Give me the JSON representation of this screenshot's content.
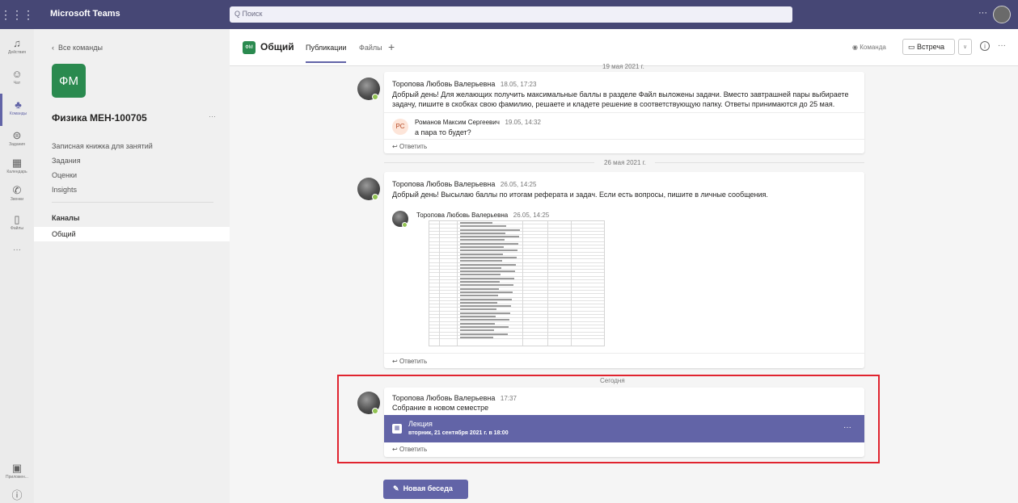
{
  "app": {
    "title": "Microsoft Teams",
    "apps_icon": "grid-icon"
  },
  "search": {
    "placeholder": "Q Поиск"
  },
  "rail": [
    {
      "label": "Действия",
      "icon": "bell-icon"
    },
    {
      "label": "Чат",
      "icon": "chat-icon"
    },
    {
      "label": "Команды",
      "icon": "teams-icon"
    },
    {
      "label": "Задания",
      "icon": "assignments-icon"
    },
    {
      "label": "Календарь",
      "icon": "calendar-icon"
    },
    {
      "label": "Звонки",
      "icon": "phone-icon"
    },
    {
      "label": "Файлы",
      "icon": "file-icon"
    }
  ],
  "rail_bottom": {
    "apps_label": "Приложен...",
    "help_icon": "help-icon"
  },
  "team_panel": {
    "back_label": "Все команды",
    "team_initials": "ФМ",
    "team_name": "Физика МЕН-100705",
    "nav": [
      "Записная книжка для занятий",
      "Задания",
      "Оценки",
      "Insights"
    ],
    "channels_title": "Каналы",
    "channels": [
      "Общий"
    ]
  },
  "header": {
    "channel_initials": "ФМ",
    "channel_name": "Общий",
    "tabs": [
      "Публикации",
      "Файлы"
    ],
    "team_button": "Команда",
    "meet_button": "Встреча"
  },
  "feed": {
    "date_top": "19 мая 2021 г.",
    "post1": {
      "author": "Торопова Любовь Валерьевна",
      "time": "18.05, 17:23",
      "text": "Добрый день! Для желающих получить максимальные баллы в разделе Файл выложены задачи. Вместо завтрашней пары выбираете задачу, пишите в скобках свою фамилию, решаете и кладете решение в соответствующую папку. Ответы принимаются до 25 мая.",
      "reply": {
        "initials": "PC",
        "author": "Романов Максим Сергеевич",
        "time": "19.05, 14:32",
        "text": "а пара то будет?"
      },
      "reply_link": "Ответить"
    },
    "date_mid": "26 мая 2021 г.",
    "post2": {
      "author": "Торопова Любовь Валерьевна",
      "time": "26.05, 14:25",
      "text": "Добрый день! Высылаю баллы по итогам реферата и задач. Если есть вопросы, пишите в личные сообщения.",
      "inner_author": "Торопова Любовь Валерьевна",
      "inner_time": "26.05, 14:25",
      "reply_link": "Ответить"
    },
    "date_today": "Сегодня",
    "post3": {
      "author": "Торопова Любовь Валерьевна",
      "time": "17:37",
      "text": "Собрание в новом семестре",
      "meeting_title": "Лекция",
      "meeting_date": "вторник, 21 сентября 2021 г. в 18:00",
      "reply_link": "Ответить"
    }
  },
  "new_conversation": "Новая беседа",
  "colors": {
    "brand": "#464775",
    "accent": "#6264a7",
    "team_green": "#2a8a4f",
    "highlight": "#e0242f"
  }
}
